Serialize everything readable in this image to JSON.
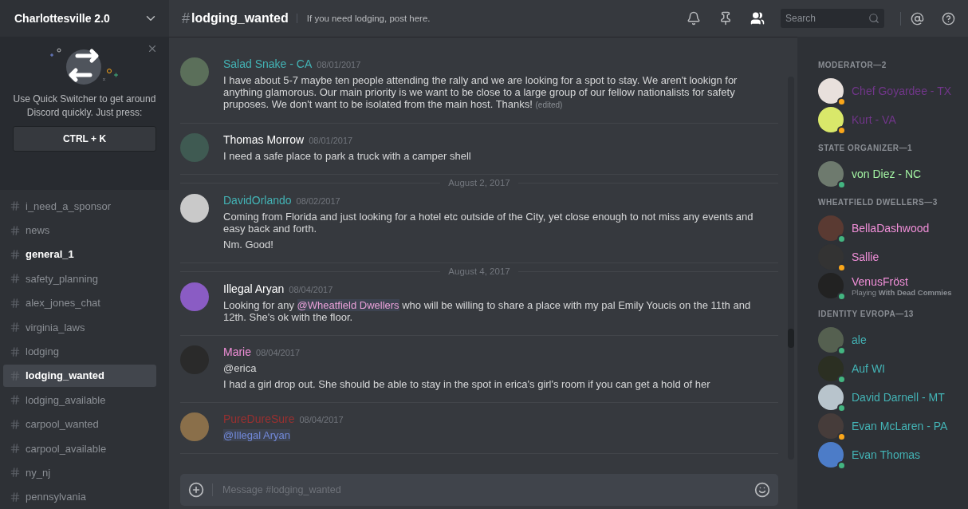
{
  "server": {
    "name": "Charlottesville 2.0"
  },
  "quick_switcher": {
    "text": "Use Quick Switcher to get around Discord quickly. Just press:",
    "shortcut": "CTRL + K"
  },
  "channels": [
    {
      "name": "i_need_a_sponsor",
      "unread": false,
      "selected": false
    },
    {
      "name": "news",
      "unread": false,
      "selected": false
    },
    {
      "name": "general_1",
      "unread": true,
      "selected": false
    },
    {
      "name": "safety_planning",
      "unread": false,
      "selected": false
    },
    {
      "name": "alex_jones_chat",
      "unread": false,
      "selected": false
    },
    {
      "name": "virginia_laws",
      "unread": false,
      "selected": false
    },
    {
      "name": "lodging",
      "unread": false,
      "selected": false
    },
    {
      "name": "lodging_wanted",
      "unread": false,
      "selected": true
    },
    {
      "name": "lodging_available",
      "unread": false,
      "selected": false
    },
    {
      "name": "carpool_wanted",
      "unread": false,
      "selected": false
    },
    {
      "name": "carpool_available",
      "unread": false,
      "selected": false
    },
    {
      "name": "ny_nj",
      "unread": false,
      "selected": false
    },
    {
      "name": "pennsylvania",
      "unread": false,
      "selected": false
    }
  ],
  "header": {
    "hash": "#",
    "channel": "lodging_wanted",
    "topic": "If you need lodging, post here.",
    "search_placeholder": "Search"
  },
  "messages": [
    {
      "kind": "message",
      "author": "Salad Snake - CA",
      "color": "#43b3b5",
      "time": "08/01/2017",
      "lines": [
        [
          {
            "kind": "text",
            "text": "I have about 5-7 maybe ten people attending the rally and we are looking for a spot to stay.  We aren't lookign for anything glamorous.  Our main priority is we want to be close to a large group of our fellow nationalists for safety pruposes.  We don't want to be isolated from the main host.  Thanks! "
          },
          {
            "kind": "edited",
            "text": "(edited)"
          }
        ]
      ]
    },
    {
      "kind": "message",
      "author": "Thomas Morrow",
      "color": "#ffffff",
      "time": "08/01/2017",
      "lines": [
        [
          {
            "kind": "text",
            "text": "I need a safe place to park a truck with a camper shell"
          }
        ]
      ]
    },
    {
      "kind": "divider",
      "text": "August 2, 2017"
    },
    {
      "kind": "message",
      "author": "DavidOrlando",
      "color": "#43b3b5",
      "time": "08/02/2017",
      "lines": [
        [
          {
            "kind": "text",
            "text": "Coming from Florida and just looking for a hotel etc outside of the City, yet close enough to not miss any events and easy back and forth."
          }
        ],
        [
          {
            "kind": "text",
            "text": "Nm. Good!"
          }
        ]
      ]
    },
    {
      "kind": "divider",
      "text": "August 4, 2017"
    },
    {
      "kind": "message",
      "author": "Illegal Aryan",
      "color": "#ffffff",
      "time": "08/04/2017",
      "lines": [
        [
          {
            "kind": "text",
            "text": "Looking for any "
          },
          {
            "kind": "mention",
            "text": "@Wheatfield Dwellers",
            "color": "#e8a0d8"
          },
          {
            "kind": "text",
            "text": " who will be willing to share a place with my pal Emily Youcis on the 11th and 12th. She's ok with the floor."
          }
        ]
      ]
    },
    {
      "kind": "message",
      "author": "Marie",
      "color": "#f08fd8",
      "time": "08/04/2017",
      "lines": [
        [
          {
            "kind": "text",
            "text": "@erica"
          }
        ],
        [
          {
            "kind": "text",
            "text": "I had a girl drop out. She should be able to stay in the spot in erica's girl's room if you can get a hold of her"
          }
        ]
      ]
    },
    {
      "kind": "message",
      "author": "PureDureSure",
      "color": "#9a3030",
      "time": "08/04/2017",
      "lines": [
        [
          {
            "kind": "mention",
            "text": "@Illegal Aryan",
            "color": "#7289da"
          }
        ]
      ]
    }
  ],
  "composer": {
    "placeholder": "Message #lodging_wanted"
  },
  "member_groups": [
    {
      "title": "MODERATOR—2",
      "members": [
        {
          "name": "Chef Goyardee - TX",
          "color": "#71368a",
          "idle": true
        },
        {
          "name": "Kurt - VA",
          "color": "#71368a",
          "idle": true
        }
      ]
    },
    {
      "title": "STATE ORGANIZER—1",
      "members": [
        {
          "name": "von Diez - NC",
          "color": "#a2f2a2",
          "idle": false
        }
      ]
    },
    {
      "title": "WHEATFIELD DWELLERS—3",
      "members": [
        {
          "name": "BellaDashwood",
          "color": "#f08fd8",
          "idle": false
        },
        {
          "name": "Sallie",
          "color": "#f08fd8",
          "idle": true
        },
        {
          "name": "VenusFröst",
          "color": "#f08fd8",
          "idle": false,
          "activity_prefix": "Playing",
          "activity": "With Dead Commies"
        }
      ]
    },
    {
      "title": "IDENTITY EVROPA—13",
      "members": [
        {
          "name": "ale",
          "color": "#43b3b5",
          "idle": false
        },
        {
          "name": "Auf WI",
          "color": "#43b3b5",
          "idle": false
        },
        {
          "name": "David Darnell - MT",
          "color": "#43b3b5",
          "idle": false
        },
        {
          "name": "Evan McLaren - PA",
          "color": "#43b3b5",
          "idle": true
        },
        {
          "name": "Evan Thomas",
          "color": "#43b3b5",
          "idle": false
        }
      ]
    }
  ]
}
